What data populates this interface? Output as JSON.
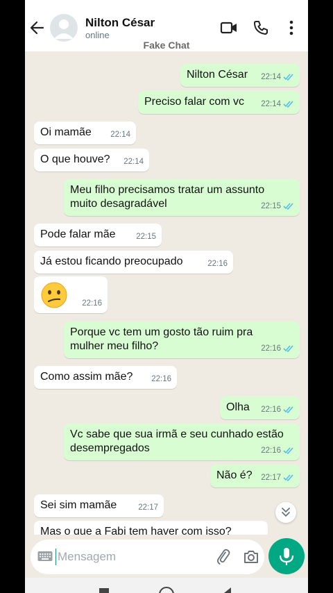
{
  "header": {
    "contact_name": "Nilton César",
    "status": "online",
    "watermark": "Fake Chat",
    "icons": [
      "back-arrow-icon",
      "avatar-placeholder-icon",
      "video-call-icon",
      "phone-icon",
      "more-options-icon"
    ]
  },
  "messages": [
    {
      "dir": "out",
      "lines": [
        "Nilton César"
      ],
      "time": "22:14",
      "read": true
    },
    {
      "dir": "out",
      "lines": [
        "Preciso falar com vc"
      ],
      "time": "22:14",
      "read": true
    },
    {
      "dir": "in",
      "lines": [
        "Oi mamãe"
      ],
      "time": "22:14"
    },
    {
      "dir": "in",
      "lines": [
        "O que houve?"
      ],
      "time": "22:14"
    },
    {
      "dir": "out",
      "lines": [
        "Meu filho precisamos tratar um assunto",
        "muito desagradável"
      ],
      "time": "22:15",
      "read": true
    },
    {
      "dir": "in",
      "lines": [
        "Pode falar mãe"
      ],
      "time": "22:15"
    },
    {
      "dir": "in",
      "lines": [
        "Já estou ficando preocupado"
      ],
      "time": "22:16"
    },
    {
      "dir": "in",
      "emoji": "confused-face-emoji",
      "lines": [],
      "time": "22:16"
    },
    {
      "dir": "out",
      "lines": [
        "Porque vc tem um gosto tão ruim pra",
        "mulher meu filho?"
      ],
      "time": "22:16",
      "read": true
    },
    {
      "dir": "in",
      "lines": [
        "Como assim mãe?"
      ],
      "time": "22:16"
    },
    {
      "dir": "out",
      "lines": [
        "Olha"
      ],
      "time": "22:16",
      "read": true
    },
    {
      "dir": "out",
      "lines": [
        "Vc sabe que sua irmã e seu cunhado estão",
        "desempregados"
      ],
      "time": "22:16",
      "read": true
    },
    {
      "dir": "out",
      "lines": [
        "Não é?"
      ],
      "time": "22:17",
      "read": true
    },
    {
      "dir": "in",
      "lines": [
        "Sei sim mamãe"
      ],
      "time": "22:17"
    },
    {
      "dir": "in",
      "lines": [
        "Mas o que a Fabi tem haver com isso?"
      ],
      "time": ""
    }
  ],
  "input": {
    "placeholder": "Mensagem",
    "icons": [
      "keyboard-icon",
      "attach-icon",
      "camera-icon",
      "mic-icon",
      "scroll-down-icon"
    ]
  },
  "colors": {
    "incoming_bubble": "#ffffff",
    "outgoing_bubble": "#d9fdd3",
    "background": "#efeae2",
    "accent": "#00a884",
    "read_ticks": "#53bdeb"
  }
}
